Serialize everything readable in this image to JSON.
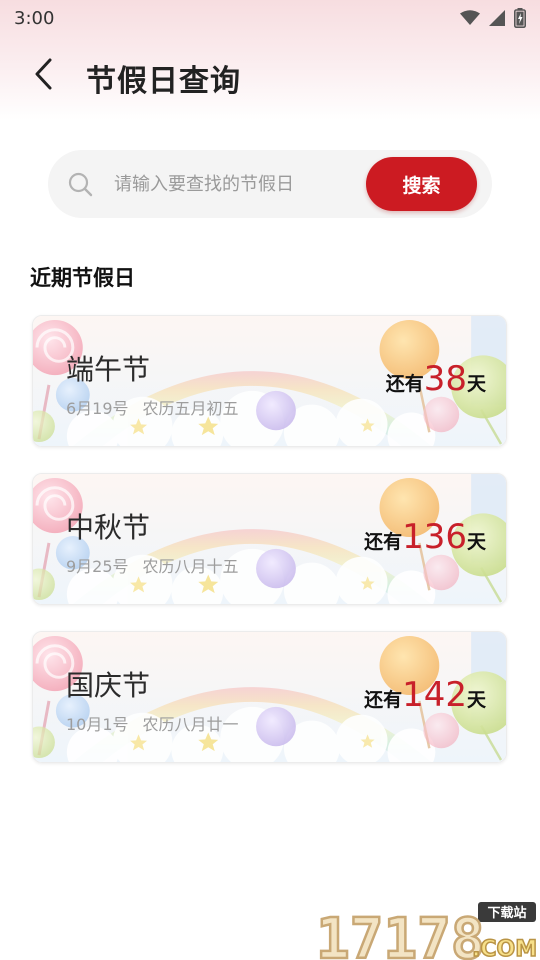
{
  "status_bar": {
    "time": "3:00"
  },
  "header": {
    "title": "节假日查询"
  },
  "search": {
    "placeholder": "请输入要查找的节假日",
    "value": "",
    "button_label": "搜索"
  },
  "section": {
    "title": "近期节假日"
  },
  "holidays": [
    {
      "name": "端午节",
      "date": "6月19号",
      "lunar": "农历五月初五",
      "prefix": "还有",
      "days": "38",
      "suffix": "天"
    },
    {
      "name": "中秋节",
      "date": "9月25号",
      "lunar": "农历八月十五",
      "prefix": "还有",
      "days": "136",
      "suffix": "天"
    },
    {
      "name": "国庆节",
      "date": "10月1号",
      "lunar": "农历八月廿一",
      "prefix": "还有",
      "days": "142",
      "suffix": "天"
    }
  ],
  "watermark": {
    "top_text": "下载站",
    "number": "17178",
    "suffix": ".COM"
  },
  "colors": {
    "accent": "#cc1b22",
    "countdown": "#c8202a",
    "header_tint": "#f7dde0"
  }
}
